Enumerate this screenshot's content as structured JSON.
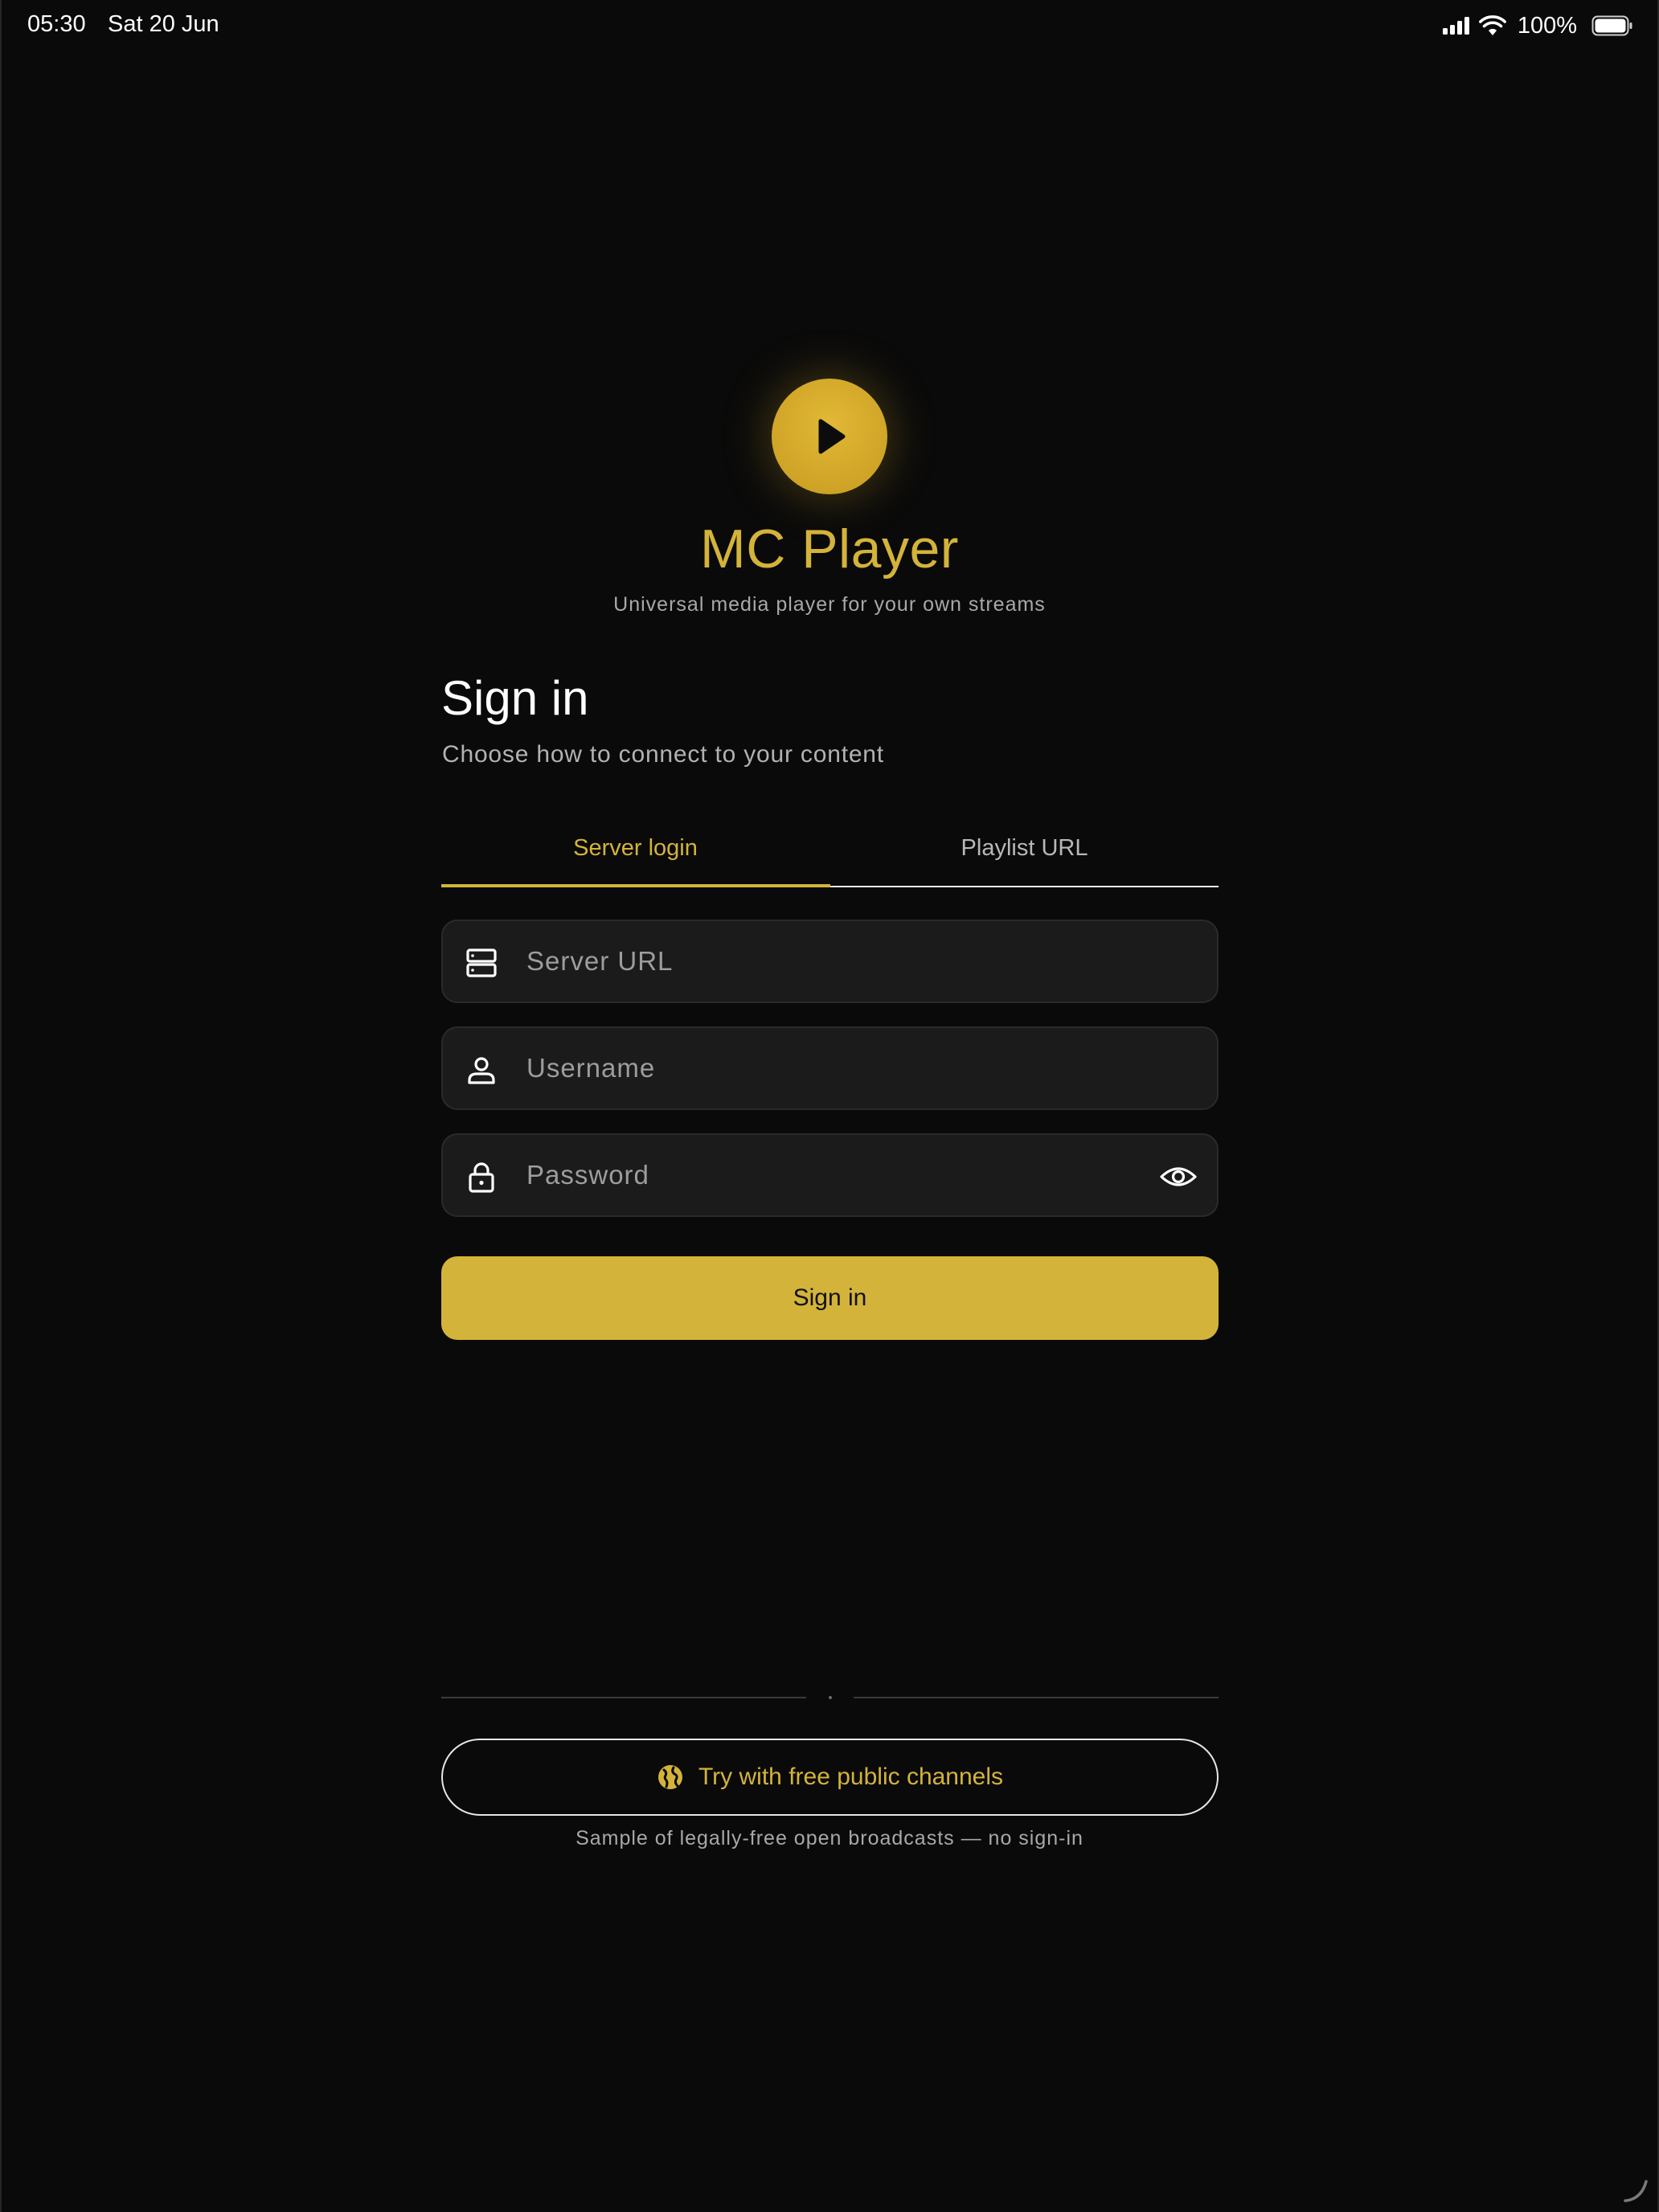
{
  "status_bar": {
    "time": "05:30",
    "date": "Sat 20 Jun",
    "battery": "100%",
    "icons": [
      "cellular-signal-icon",
      "wifi-icon",
      "battery-icon"
    ]
  },
  "app": {
    "logo_icon": "play-icon",
    "title": "MC Player",
    "subtitle": "Universal media player for your own streams"
  },
  "signin": {
    "heading": "Sign in",
    "subheading": "Choose how to connect to your content",
    "tabs": [
      {
        "label": "Server login",
        "active": true
      },
      {
        "label": "Playlist URL",
        "active": false
      }
    ],
    "fields": {
      "server_url": {
        "placeholder": "Server URL",
        "value": "",
        "icon": "server-icon"
      },
      "username": {
        "placeholder": "Username",
        "value": "",
        "icon": "user-icon"
      },
      "password": {
        "placeholder": "Password",
        "value": "",
        "icon": "lock-icon",
        "toggle_icon": "eye-icon"
      }
    },
    "submit_label": "Sign in"
  },
  "public_channels": {
    "button_label": "Try with free public channels",
    "icon": "globe-icon",
    "note": "Sample of legally-free open broadcasts — no sign-in"
  },
  "colors": {
    "background": "#0a0a0a",
    "accent": "#d4b33a",
    "field_bg": "#1b1b1b",
    "muted_text": "#a8a8a8"
  }
}
